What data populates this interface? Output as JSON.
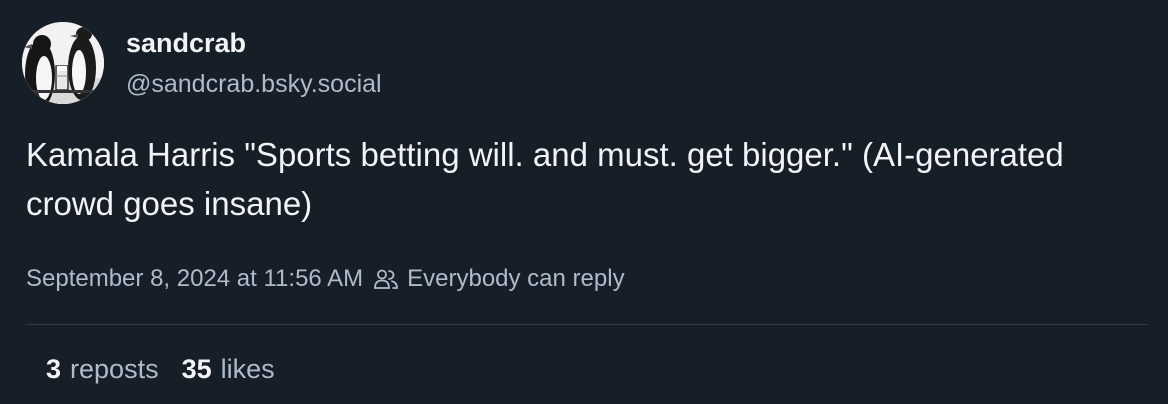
{
  "author": {
    "display_name": "sandcrab",
    "handle": "@sandcrab.bsky.social",
    "avatar_icon": "penguin-with-beer-glass"
  },
  "post": {
    "text": "Kamala Harris \"Sports betting will. and must. get bigger.\" (AI-generated crowd goes insane)"
  },
  "meta": {
    "timestamp": "September 8, 2024 at 11:56 AM",
    "reply_icon": "people-icon",
    "reply_setting": "Everybody can reply"
  },
  "stats": {
    "reposts_count": "3",
    "reposts_label": "reposts",
    "likes_count": "35",
    "likes_label": "likes"
  },
  "colors": {
    "background": "#161e27",
    "text_primary": "#f1f3f5",
    "text_secondary": "#aebbc9",
    "divider": "#2e3a48"
  }
}
